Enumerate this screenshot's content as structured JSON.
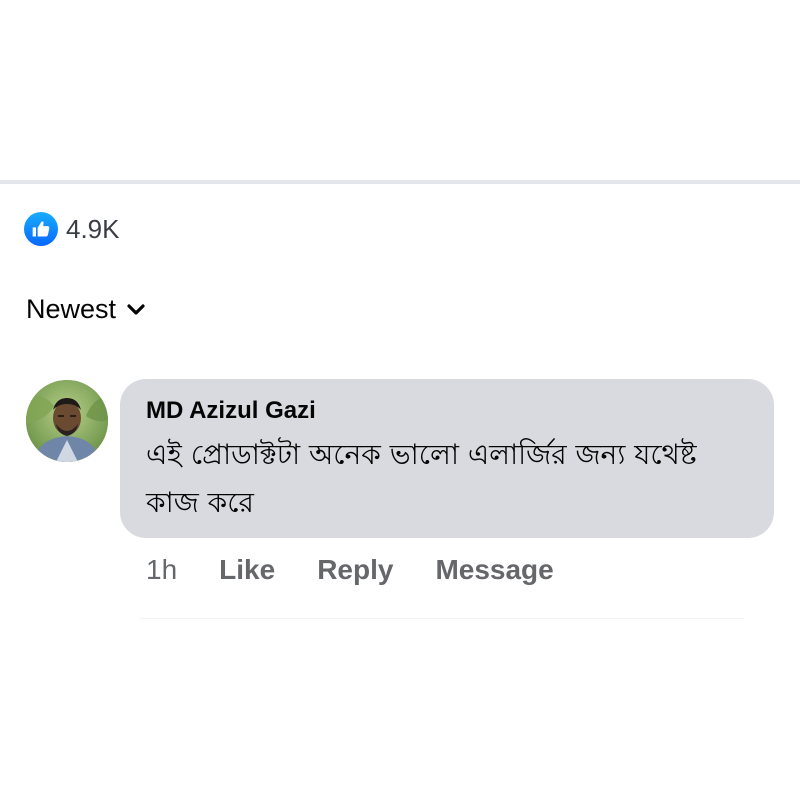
{
  "reactions": {
    "icon": "like-thumbs-up-icon",
    "count": "4.9K",
    "accent": "#0866ff"
  },
  "sort": {
    "label": "Newest",
    "icon": "chevron-down-icon"
  },
  "comment": {
    "author": "MD Azizul Gazi",
    "text": "এই প্রোডাক্টটা অনেক ভালো এলার্জির জন্য যথেষ্ট কাজ করে",
    "bubble_color": "#d8dadf",
    "avatar": "avatar-photo"
  },
  "actions": {
    "time": "1h",
    "like": "Like",
    "reply": "Reply",
    "message": "Message"
  }
}
